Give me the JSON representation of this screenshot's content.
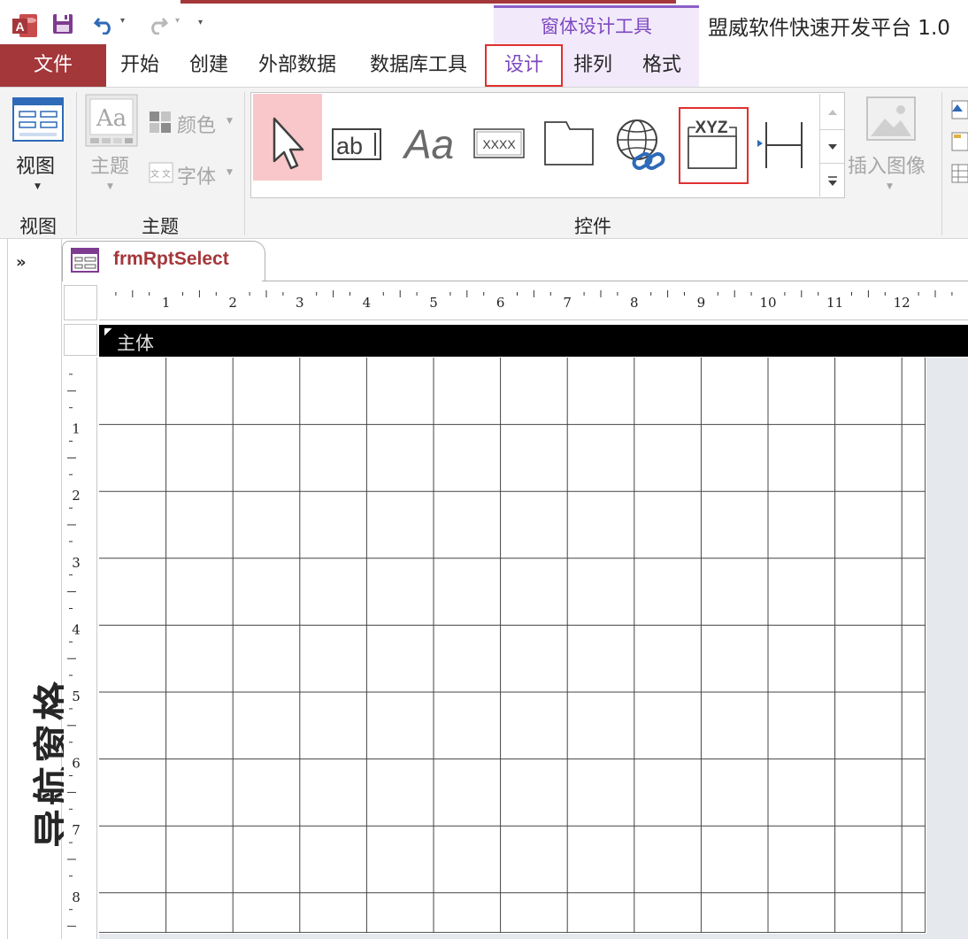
{
  "qat": {
    "app_icon": "access-app-icon",
    "save_icon": "save-icon",
    "undo_icon": "undo-icon",
    "redo_icon": "redo-icon",
    "customize_icon": "customize-qat-icon"
  },
  "title": {
    "context_group": "窗体设计工具",
    "window_title": "盟威软件快速开发平台 1.0"
  },
  "tabs": {
    "file": "文件",
    "home": "开始",
    "create": "创建",
    "external": "外部数据",
    "dbtools": "数据库工具",
    "design": "设计",
    "arrange": "排列",
    "format": "格式"
  },
  "ribbon": {
    "view": {
      "label": "视图",
      "group": "视图"
    },
    "theme": {
      "label": "主题",
      "colors": "颜色",
      "fonts": "字体",
      "group": "主题"
    },
    "controls": {
      "group": "控件",
      "textbox_text": "ab",
      "label_text": "Aa",
      "button_text": "XXXX",
      "navigation_text": "XYZ"
    },
    "insert_image": "插入图像"
  },
  "nav_pane": {
    "label": "导航窗格",
    "expand_icon": "chevron-double-right-icon"
  },
  "document": {
    "tab_label": "frmRptSelect",
    "section": "主体",
    "hruler_ticks": [
      "1",
      "2",
      "3",
      "4",
      "5",
      "6",
      "7",
      "8",
      "9",
      "10",
      "11",
      "12"
    ],
    "vruler_ticks": [
      "1",
      "2",
      "3",
      "4",
      "5",
      "6",
      "7",
      "8"
    ]
  }
}
